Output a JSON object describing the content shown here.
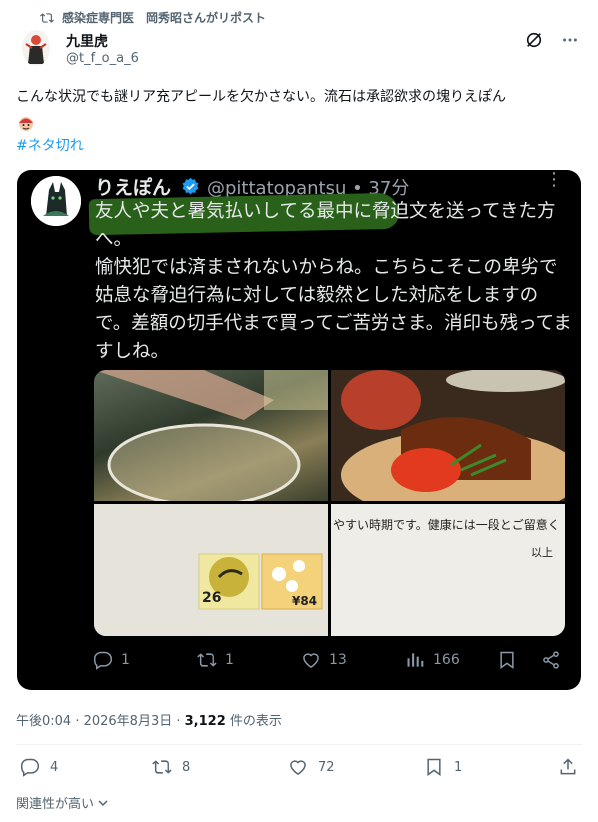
{
  "repost": {
    "text": "感染症専門医　岡秀昭さんがリポスト"
  },
  "author": {
    "name": "九里虎",
    "handle": "@t_f_o_a_6"
  },
  "tweet": {
    "text": "こんな状況でも謎リア充アピールを欠かさない。流石は承認欲求の塊りえぽん",
    "hashtag": "#ネタ切れ"
  },
  "embedded": {
    "name": "りえぽん",
    "handle_time": "@pittatopantsu • 37分",
    "text": "友人や夫と暑気払いしてる最中に脅迫文を送ってきた方へ。\n愉快犯では済まされないからね。こちらこそこの卑劣で姑息な脅迫行為に対しては毅然とした対応をしますので。差額の切手代まで買ってご苦労さま。消印も残ってますしね。",
    "note_text": "やすい時期です。健康には一段とご留意く",
    "note_closing": "以上",
    "stamp_values": [
      "26",
      "¥84"
    ],
    "replies": "1",
    "reposts": "1",
    "likes": "13",
    "views": "166"
  },
  "meta": {
    "time": "午後0:04 · 2026年8月3日 · ",
    "views_count": "3,122",
    "views_label": " 件の表示"
  },
  "actions": {
    "replies": "4",
    "reposts": "8",
    "likes": "72",
    "bookmarks": "1"
  },
  "relevance": {
    "label": "関連性が高い"
  },
  "colors": {
    "accent": "#1d9bf0",
    "muted": "#536471",
    "highlight": "#2e6b1d"
  }
}
